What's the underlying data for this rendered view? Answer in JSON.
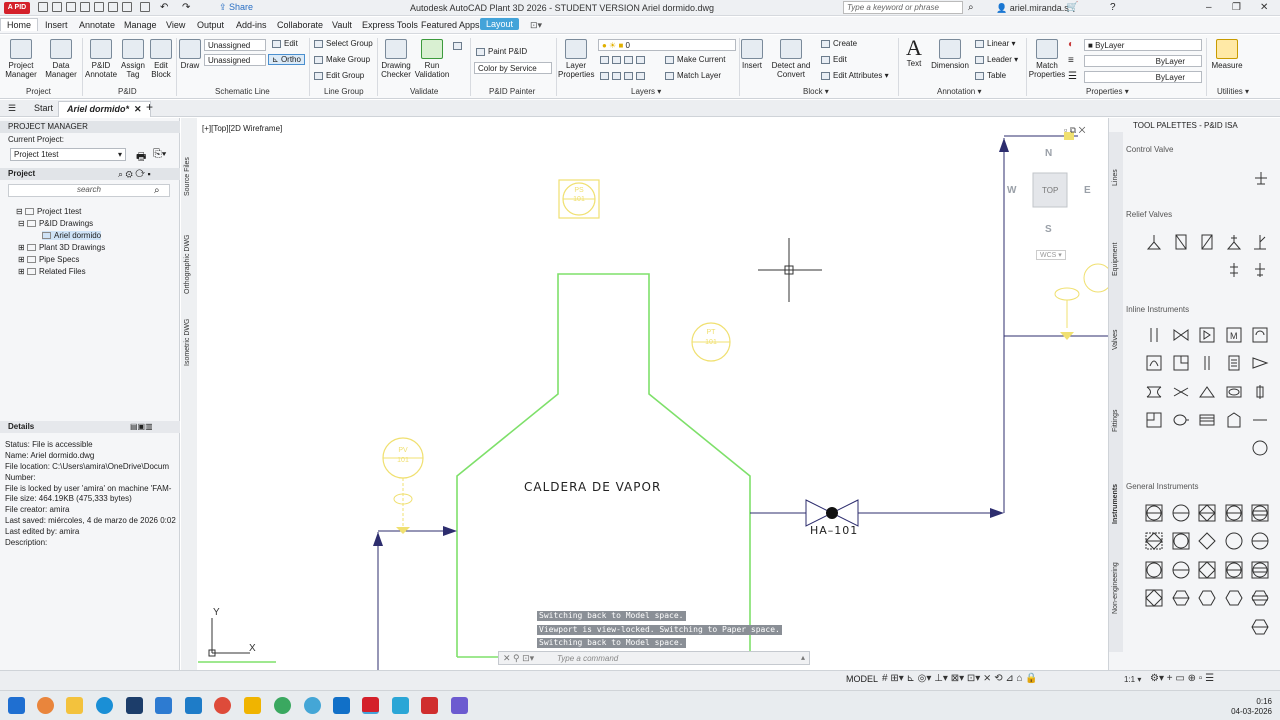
{
  "app": {
    "logo": "A PID",
    "title": "Autodesk AutoCAD Plant 3D 2026 - STUDENT VERSION    Ariel dormido.dwg",
    "share": "Share",
    "search_placeholder": "Type a keyword or phrase",
    "user": "ariel.miranda.s"
  },
  "menu_tabs": [
    "Home",
    "Insert",
    "Annotate",
    "Manage",
    "View",
    "Output",
    "Add-ins",
    "Collaborate",
    "Vault",
    "Express Tools",
    "Featured Apps",
    "Layout"
  ],
  "ribbon": {
    "project_manager": "Project\nManager",
    "data_manager": "Data\nManager",
    "pid_annotate": "P&ID\nAnnotate",
    "assign_tag": "Assign\nTag",
    "edit_block": "Edit\nBlock",
    "draw": "Draw",
    "unassigned_1": "Unassigned",
    "unassigned_2": "Unassigned",
    "edit": "Edit",
    "ortho": "Ortho",
    "select_group": "Select Group",
    "make_group": "Make Group",
    "edit_group": "Edit Group",
    "drawing_checker": "Drawing\nChecker",
    "run_validation": "Run\nValidation",
    "paint_pid": "Paint P&ID",
    "color_by_service": "Color by Service",
    "layer_properties": "Layer\nProperties",
    "layer_value": "0",
    "make_current": "Make Current",
    "match_layer": "Match Layer",
    "insert": "Insert",
    "detect_convert": "Detect and\nConvert",
    "create": "Create",
    "block_edit": "Edit",
    "edit_attributes": "Edit Attributes",
    "text": "Text",
    "dimension": "Dimension",
    "linear": "Linear",
    "leader": "Leader",
    "table": "Table",
    "match_properties": "Match\nProperties",
    "bylayer_1": "ByLayer",
    "bylayer_2": "ByLayer",
    "bylayer_3": "ByLayer",
    "measure": "Measure",
    "groups": {
      "project": "Project",
      "pid": "P&ID",
      "schematic_line": "Schematic Line",
      "line_group": "Line Group",
      "validate": "Validate",
      "pid_painter": "P&ID Painter",
      "layers": "Layers",
      "block": "Block",
      "annotation": "Annotation",
      "properties": "Properties",
      "utilities": "Utilities"
    }
  },
  "file_tabs": {
    "start": "Start",
    "current": "Ariel dormido*"
  },
  "project_manager": {
    "title": "PROJECT MANAGER",
    "current_project_label": "Current Project:",
    "current_project": "Project 1test",
    "project_header": "Project",
    "search_placeholder": "search",
    "tree": [
      "Project 1test",
      "P&ID Drawings",
      "Ariel dormido",
      "Plant 3D Drawings",
      "Pipe Specs",
      "Related Files"
    ],
    "side_tabs": [
      "Source Files",
      "Orthographic DWG",
      "Isometric DWG"
    ],
    "details_header": "Details",
    "details": [
      "Status: File is accessible",
      "Name: Ariel dormido.dwg",
      "File location: C:\\Users\\amira\\OneDrive\\Docum",
      "Number:",
      "File is locked by user 'amira' on machine 'FAM-",
      "File size: 464.19KB (475,333 bytes)",
      "File creator: amira",
      "Last saved: miércoles, 4 de marzo de 2026 0:02",
      "Last edited by: amira",
      "Description:"
    ]
  },
  "viewport": {
    "label": "[+][Top][2D Wireframe]",
    "boiler_label": "CALDERA DE VAPOR",
    "valve_tag": "HA–101",
    "instrument_1": [
      "PS",
      "101"
    ],
    "instrument_2": [
      "PT",
      "101"
    ],
    "instrument_3": [
      "PV",
      "101"
    ],
    "viewcube": {
      "n": "N",
      "s": "S",
      "e": "E",
      "w": "W",
      "top": "TOP",
      "wcs": "WCS"
    },
    "ucs_x": "X",
    "ucs_y": "Y"
  },
  "command": {
    "history": [
      "Switching back to Model space.",
      "Viewport is view-locked. Switching to Paper space.",
      "Switching back to Model space."
    ],
    "placeholder": "Type a command"
  },
  "tool_palettes": {
    "title": "TOOL PALETTES - P&ID ISA",
    "sections": [
      "Control Valve",
      "Relief Valves",
      "Inline Instruments",
      "General Instruments"
    ],
    "tabs": [
      "Lines",
      "Equipment",
      "Valves",
      "Fittings",
      "Instruments",
      "Non-engineering"
    ]
  },
  "status": {
    "model": "MODEL",
    "scale": "1:1"
  },
  "clock": {
    "time": "0:16",
    "date": "04-03-2026"
  },
  "colors": {
    "boiler_outline": "#7ee06a",
    "instrument_yellow": "#f0e070",
    "line_blue": "#2d2d6e",
    "accent": "#43a3d9"
  }
}
